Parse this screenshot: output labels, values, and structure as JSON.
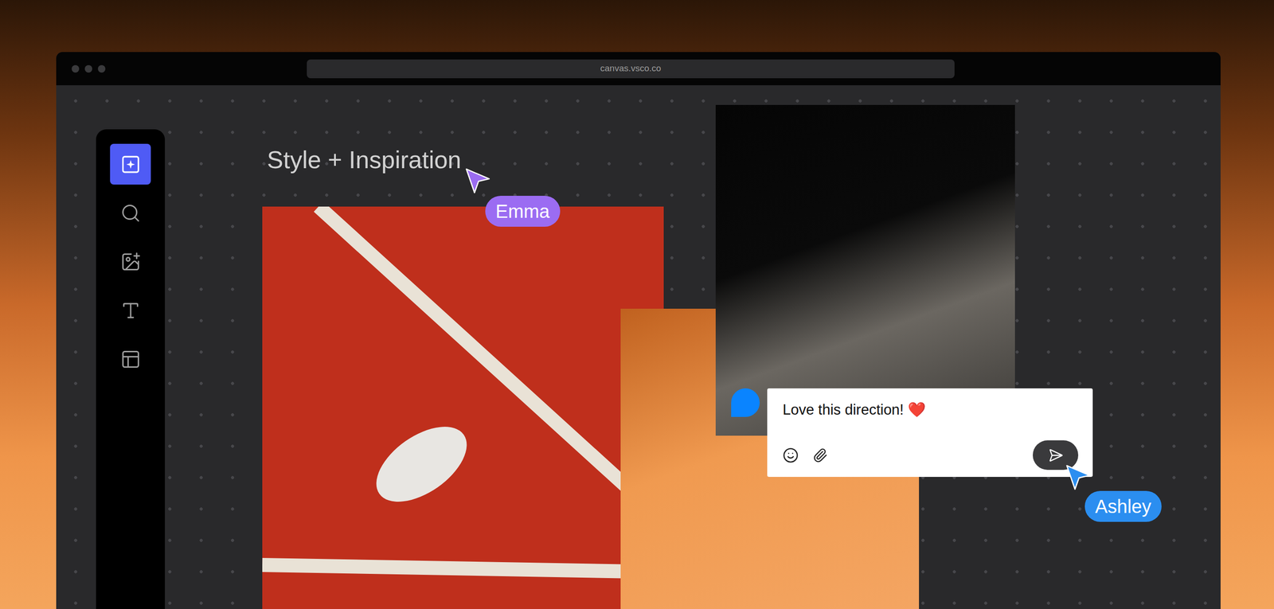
{
  "browser": {
    "url": "canvas.vsco.co"
  },
  "toolbar": {
    "items": [
      {
        "kind": "ai",
        "selected": true
      },
      {
        "kind": "search",
        "selected": false
      },
      {
        "kind": "image",
        "selected": false
      },
      {
        "kind": "text",
        "selected": false
      },
      {
        "kind": "layout",
        "selected": false
      }
    ]
  },
  "canvas": {
    "heading": "Style + Inspiration"
  },
  "cursors": [
    {
      "name": "Emma",
      "color": "#9b6cf2"
    },
    {
      "name": "Ashley",
      "color": "#2b8ef0"
    }
  ],
  "comment": {
    "text": "Love this direction! ❤️"
  }
}
